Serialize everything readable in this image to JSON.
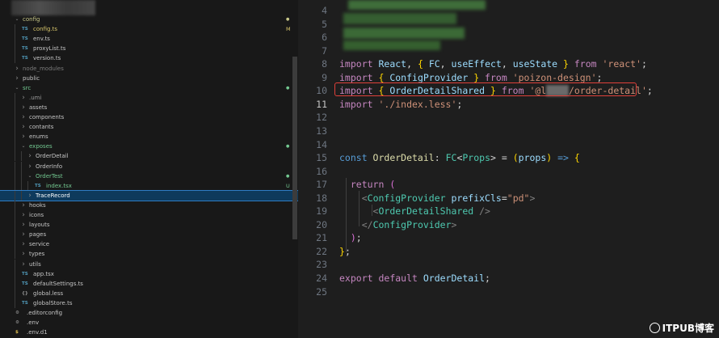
{
  "explorer": {
    "items": [
      {
        "name": "config",
        "type": "folder",
        "open": true,
        "depth": 0,
        "status": "dot",
        "color": "#c9c98a"
      },
      {
        "name": "config.ts",
        "type": "ts",
        "depth": 1,
        "status": "M",
        "color": "#d7c56b"
      },
      {
        "name": "env.ts",
        "type": "ts",
        "depth": 1,
        "status": "",
        "color": "#c5c5c5"
      },
      {
        "name": "proxyList.ts",
        "type": "ts",
        "depth": 1,
        "status": "",
        "color": "#c5c5c5"
      },
      {
        "name": "version.ts",
        "type": "ts",
        "depth": 1,
        "status": "",
        "color": "#c5c5c5"
      },
      {
        "name": "node_modules",
        "type": "folder",
        "open": false,
        "depth": 0,
        "status": "",
        "color": "#7a7a7a"
      },
      {
        "name": "public",
        "type": "folder",
        "open": false,
        "depth": 0,
        "status": "",
        "color": "#c5c5c5"
      },
      {
        "name": "src",
        "type": "folder",
        "open": true,
        "depth": 0,
        "status": "dot",
        "color": "#73c991"
      },
      {
        "name": ".umi",
        "type": "folder",
        "open": false,
        "depth": 1,
        "status": "",
        "color": "#9a9a9a"
      },
      {
        "name": "assets",
        "type": "folder",
        "open": false,
        "depth": 1,
        "status": "",
        "color": "#c5c5c5"
      },
      {
        "name": "components",
        "type": "folder",
        "open": false,
        "depth": 1,
        "status": "",
        "color": "#c5c5c5"
      },
      {
        "name": "contants",
        "type": "folder",
        "open": false,
        "depth": 1,
        "status": "",
        "color": "#c5c5c5"
      },
      {
        "name": "enums",
        "type": "folder",
        "open": false,
        "depth": 1,
        "status": "",
        "color": "#c5c5c5"
      },
      {
        "name": "exposes",
        "type": "folder",
        "open": true,
        "depth": 1,
        "status": "dot",
        "color": "#73c991"
      },
      {
        "name": "OrderDetail",
        "type": "folder",
        "open": false,
        "depth": 2,
        "status": "",
        "color": "#c5c5c5"
      },
      {
        "name": "OrderInfo",
        "type": "folder",
        "open": false,
        "depth": 2,
        "status": "",
        "color": "#c5c5c5"
      },
      {
        "name": "OrderTest",
        "type": "folder",
        "open": true,
        "depth": 2,
        "status": "dot",
        "color": "#73c991"
      },
      {
        "name": "index.tsx",
        "type": "ts",
        "depth": 3,
        "status": "U",
        "color": "#73c991"
      },
      {
        "name": "TraceRecord",
        "type": "folder",
        "open": false,
        "depth": 2,
        "status": "",
        "color": "#ffffff",
        "selected": true
      },
      {
        "name": "hooks",
        "type": "folder",
        "open": false,
        "depth": 1,
        "status": "",
        "color": "#c5c5c5"
      },
      {
        "name": "icons",
        "type": "folder",
        "open": false,
        "depth": 1,
        "status": "",
        "color": "#c5c5c5"
      },
      {
        "name": "layouts",
        "type": "folder",
        "open": false,
        "depth": 1,
        "status": "",
        "color": "#c5c5c5"
      },
      {
        "name": "pages",
        "type": "folder",
        "open": false,
        "depth": 1,
        "status": "",
        "color": "#c5c5c5"
      },
      {
        "name": "service",
        "type": "folder",
        "open": false,
        "depth": 1,
        "status": "",
        "color": "#c5c5c5"
      },
      {
        "name": "types",
        "type": "folder",
        "open": false,
        "depth": 1,
        "status": "",
        "color": "#c5c5c5"
      },
      {
        "name": "utils",
        "type": "folder",
        "open": false,
        "depth": 1,
        "status": "",
        "color": "#c5c5c5"
      },
      {
        "name": "app.tsx",
        "type": "ts",
        "depth": 1,
        "status": "",
        "color": "#c5c5c5"
      },
      {
        "name": "defaultSettings.ts",
        "type": "ts",
        "depth": 1,
        "status": "",
        "color": "#c5c5c5"
      },
      {
        "name": "global.less",
        "type": "less",
        "depth": 1,
        "status": "",
        "color": "#c5c5c5"
      },
      {
        "name": "globalStore.ts",
        "type": "ts",
        "depth": 1,
        "status": "",
        "color": "#c5c5c5"
      },
      {
        "name": ".editorconfig",
        "type": "gear",
        "depth": 0,
        "status": "",
        "color": "#c5c5c5"
      },
      {
        "name": ".env",
        "type": "gear",
        "depth": 0,
        "status": "",
        "color": "#c5c5c5"
      },
      {
        "name": ".env.d1",
        "type": "env",
        "depth": 0,
        "status": "",
        "color": "#c5c5c5"
      }
    ],
    "icon_labels": {
      "ts": "TS",
      "less": "{}",
      "gear": "⚙",
      "env": "$"
    }
  },
  "editor": {
    "lines": [
      {
        "num": "4",
        "tokens": []
      },
      {
        "num": "5",
        "tokens": []
      },
      {
        "num": "6",
        "tokens": []
      },
      {
        "num": "7",
        "tokens": []
      },
      {
        "num": "8",
        "tokens": [
          {
            "t": "import ",
            "c": "kw"
          },
          {
            "t": "React",
            "c": "id"
          },
          {
            "t": ", ",
            "c": "pl"
          },
          {
            "t": "{",
            "c": "br1"
          },
          {
            "t": " FC",
            "c": "id"
          },
          {
            "t": ", ",
            "c": "pl"
          },
          {
            "t": "useEffect",
            "c": "id"
          },
          {
            "t": ", ",
            "c": "pl"
          },
          {
            "t": "useState ",
            "c": "id"
          },
          {
            "t": "}",
            "c": "br1"
          },
          {
            "t": " from ",
            "c": "kw"
          },
          {
            "t": "'react'",
            "c": "st"
          },
          {
            "t": ";",
            "c": "pl"
          }
        ]
      },
      {
        "num": "9",
        "tokens": [
          {
            "t": "import ",
            "c": "kw"
          },
          {
            "t": "{",
            "c": "br1"
          },
          {
            "t": " ConfigProvider ",
            "c": "id"
          },
          {
            "t": "}",
            "c": "br1"
          },
          {
            "t": " from ",
            "c": "kw"
          },
          {
            "t": "'poizon-design'",
            "c": "st"
          },
          {
            "t": ";",
            "c": "pl"
          }
        ]
      },
      {
        "num": "10",
        "tokens": [
          {
            "t": "import ",
            "c": "kw"
          },
          {
            "t": "{",
            "c": "br1"
          },
          {
            "t": " OrderDetailShared ",
            "c": "id"
          },
          {
            "t": "}",
            "c": "br1"
          },
          {
            "t": " from ",
            "c": "kw"
          },
          {
            "t": "'@l",
            "c": "st"
          },
          {
            "t": "    ",
            "c": "blur"
          },
          {
            "t": "/order-detail'",
            "c": "st"
          },
          {
            "t": ";",
            "c": "pl"
          }
        ]
      },
      {
        "num": "11",
        "current": true,
        "tokens": [
          {
            "t": "import ",
            "c": "kw"
          },
          {
            "t": "'./index.less'",
            "c": "st"
          },
          {
            "t": ";",
            "c": "pl"
          }
        ]
      },
      {
        "num": "12",
        "tokens": []
      },
      {
        "num": "13",
        "tokens": []
      },
      {
        "num": "14",
        "tokens": []
      },
      {
        "num": "15",
        "tokens": [
          {
            "t": "const ",
            "c": "decl"
          },
          {
            "t": "OrderDetail",
            "c": "fn"
          },
          {
            "t": ": ",
            "c": "pl"
          },
          {
            "t": "FC",
            "c": "ty"
          },
          {
            "t": "<",
            "c": "pl"
          },
          {
            "t": "Props",
            "c": "ty"
          },
          {
            "t": "> = ",
            "c": "pl"
          },
          {
            "t": "(",
            "c": "br1"
          },
          {
            "t": "props",
            "c": "id"
          },
          {
            "t": ")",
            "c": "br1"
          },
          {
            "t": " => ",
            "c": "decl"
          },
          {
            "t": "{",
            "c": "br1"
          }
        ]
      },
      {
        "num": "16",
        "tokens": []
      },
      {
        "num": "17",
        "tokens": [
          {
            "t": "  return ",
            "c": "kw"
          },
          {
            "t": "(",
            "c": "br2"
          }
        ]
      },
      {
        "num": "18",
        "tokens": [
          {
            "t": "    ",
            "c": "pl"
          },
          {
            "t": "<",
            "c": "ang"
          },
          {
            "t": "ConfigProvider",
            "c": "tag"
          },
          {
            "t": " prefixCls",
            "c": "at"
          },
          {
            "t": "=",
            "c": "pl"
          },
          {
            "t": "\"pd\"",
            "c": "st"
          },
          {
            "t": ">",
            "c": "ang"
          }
        ]
      },
      {
        "num": "19",
        "tokens": [
          {
            "t": "      ",
            "c": "pl"
          },
          {
            "t": "<",
            "c": "ang"
          },
          {
            "t": "OrderDetailShared",
            "c": "tag"
          },
          {
            "t": " />",
            "c": "ang"
          }
        ]
      },
      {
        "num": "20",
        "tokens": [
          {
            "t": "    ",
            "c": "pl"
          },
          {
            "t": "</",
            "c": "ang"
          },
          {
            "t": "ConfigProvider",
            "c": "tag"
          },
          {
            "t": ">",
            "c": "ang"
          }
        ]
      },
      {
        "num": "21",
        "tokens": [
          {
            "t": "  ",
            "c": "pl"
          },
          {
            "t": ")",
            "c": "br2"
          },
          {
            "t": ";",
            "c": "pl"
          }
        ]
      },
      {
        "num": "22",
        "tokens": [
          {
            "t": "}",
            "c": "br1"
          },
          {
            "t": ";",
            "c": "pl"
          }
        ]
      },
      {
        "num": "23",
        "tokens": []
      },
      {
        "num": "24",
        "tokens": [
          {
            "t": "export ",
            "c": "kw"
          },
          {
            "t": "default ",
            "c": "kw"
          },
          {
            "t": "OrderDetail",
            "c": "id"
          },
          {
            "t": ";",
            "c": "pl"
          }
        ]
      },
      {
        "num": "25",
        "tokens": []
      }
    ]
  },
  "watermark": {
    "text": "ITPUB博客"
  }
}
